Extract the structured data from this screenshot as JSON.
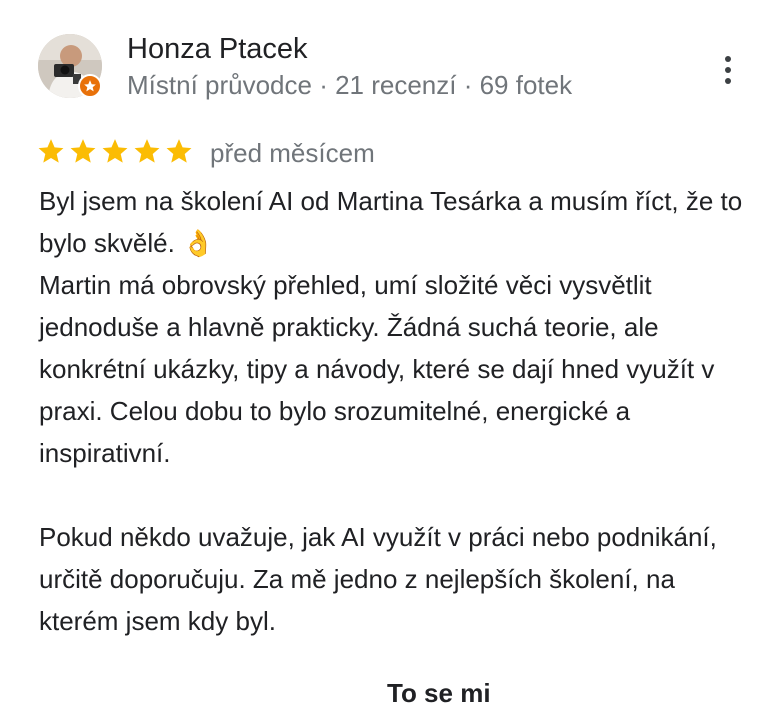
{
  "reviewer": {
    "name": "Honza Ptacek",
    "meta": "Místní průvodce · 21 recenzí · 69 fotek",
    "badge_icon": "local-guide-star-icon"
  },
  "rating": {
    "stars": 5,
    "max": 5,
    "star_color": "#fbbc04",
    "date": "před měsícem"
  },
  "review": {
    "paragraphs": [
      "Byl jsem na školení AI od Martina Tesárka a musím říct, že to bylo skvělé. 👌",
      "Martin má obrovský přehled, umí složité věci vysvětlit jednoduše a hlavně prakticky. Žádná suchá teorie, ale konkrétní ukázky, tipy a návody, které se dají hned využít v praxi. Celou dobu to bylo srozumitelné, energické a inspirativní.",
      "Pokud někdo uvažuje, jak AI využít v práci nebo podnikání, určitě doporučuju. Za mě jedno z nejlepších školení, na kterém jsem kdy byl."
    ]
  },
  "menu": {
    "icon": "more-vertical-icon"
  },
  "actions": {
    "bottom_label": "To se mi"
  }
}
